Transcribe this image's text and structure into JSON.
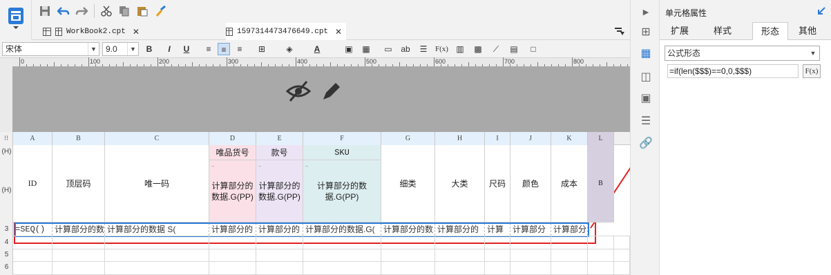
{
  "tabs": [
    {
      "label": "WorkBook2.cpt"
    },
    {
      "label": "1597314473476649.cpt"
    }
  ],
  "format": {
    "font": "宋体",
    "size": "9.0",
    "bold": "B",
    "italic": "I",
    "underline": "U",
    "text_color_label": "A",
    "ab_label": "ab",
    "fx_label": "F(x)"
  },
  "ruler": {
    "labels": [
      "0",
      "100",
      "200",
      "300",
      "400",
      "500",
      "600",
      "700",
      "800"
    ]
  },
  "columns": [
    "A",
    "B",
    "C",
    "D",
    "E",
    "F",
    "G",
    "H",
    "I",
    "J",
    "K",
    "L"
  ],
  "row_labels": {
    "h1": "(H)",
    "h2": "(H)",
    "r3": "3",
    "r4": "4",
    "r5": "5",
    "r6": "6"
  },
  "header_top": {
    "D": "唯品货号",
    "E": "款号",
    "F": "SKU"
  },
  "header_main": {
    "A": "ID",
    "B": "顶层码",
    "C": "唯一码",
    "D": "计算部分的数据.G(PP)",
    "E": "计算部分的数据.G(PP)",
    "F": "计算部分的数据.G(PP)",
    "G": "细类",
    "H": "大类",
    "I": "尺码",
    "J": "颜色",
    "K": "成本",
    "L": "B"
  },
  "row3": {
    "A": "=SEQ()",
    "B": "计算部分的数",
    "C": "计算部分的数据 S(",
    "D": "计算部分的",
    "E": "计算部分的",
    "F": "计算部分的数据.G(",
    "G": "计算部分的数",
    "H": "计算部分的",
    "I": "计算",
    "J": "计算部分",
    "K": "计算部分"
  },
  "panel": {
    "title": "单元格属性",
    "tabs": [
      "扩展",
      "样式",
      "形态",
      "其他"
    ],
    "active_tab": "形态",
    "form_type": "公式形态",
    "formula": "=if(len($$$)==0,0,$$$)",
    "fx_label": "F(x)"
  },
  "colors": {
    "accent": "#2b7bd6",
    "highlight": "#e02020",
    "header_pink": "#fbe0e8",
    "header_purple": "#ece4f5",
    "header_teal": "#ddeef0"
  }
}
